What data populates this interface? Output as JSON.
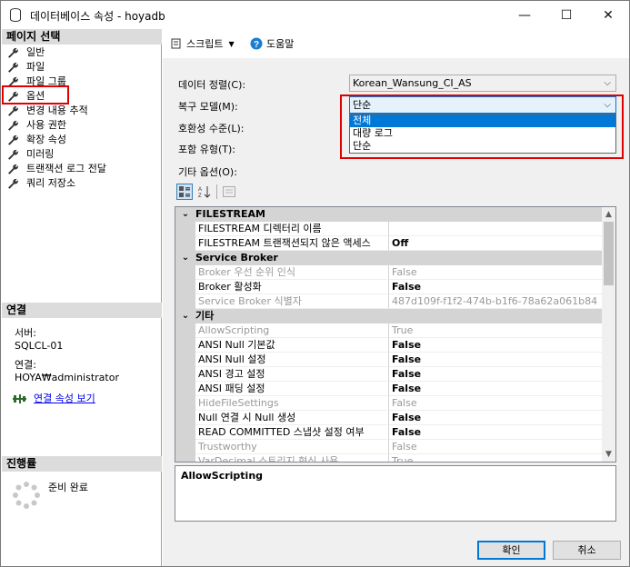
{
  "window": {
    "title": "데이터베이스 속성 - hoyadb",
    "minimize": "—",
    "maximize": "☐",
    "close": "✕"
  },
  "left": {
    "select_page_header": "페이지 선택",
    "pages": [
      "일반",
      "파일",
      "파일 그룹",
      "옵션",
      "변경 내용 추적",
      "사용 권한",
      "확장 속성",
      "미러링",
      "트랜잭션 로그 전달",
      "쿼리 저장소"
    ],
    "selected_page": "옵션",
    "connection_header": "연결",
    "server_label": "서버:",
    "server_value": "SQLCL-01",
    "connection_label": "연결:",
    "connection_value": "HOYA₩administrator",
    "view_connection_link": "연결 속성 보기",
    "progress_header": "진행률",
    "progress_status": "준비 완료"
  },
  "toolbar": {
    "script_label": "스크립트",
    "help_label": "도움말"
  },
  "form": {
    "collation_label": "데이터 정렬(C):",
    "collation_value": "Korean_Wansung_CI_AS",
    "recovery_label": "복구 모델(M):",
    "recovery_value": "단순",
    "recovery_options": [
      "전체",
      "대량 로그",
      "단순"
    ],
    "recovery_highlighted": "전체",
    "compat_label": "호환성 수준(L):",
    "containment_label": "포함 유형(T):",
    "other_options_label": "기타 옵션(O):"
  },
  "grid": {
    "rows": [
      {
        "type": "cat",
        "name": "FILESTREAM"
      },
      {
        "type": "prop",
        "name": "FILESTREAM 디렉터리 이름",
        "value": "",
        "disabled": false,
        "bold": false
      },
      {
        "type": "prop",
        "name": "FILESTREAM 트랜잭션되지 않은 액세스",
        "value": "Off",
        "disabled": false,
        "bold": true
      },
      {
        "type": "cat",
        "name": "Service Broker"
      },
      {
        "type": "prop",
        "name": "Broker 우선 순위 인식",
        "value": "False",
        "disabled": true,
        "bold": false
      },
      {
        "type": "prop",
        "name": "Broker 활성화",
        "value": "False",
        "disabled": false,
        "bold": true
      },
      {
        "type": "prop",
        "name": "Service Broker 식별자",
        "value": "487d109f-f1f2-474b-b1f6-78a62a061b84",
        "disabled": true,
        "bold": false
      },
      {
        "type": "cat",
        "name": "기타"
      },
      {
        "type": "prop",
        "name": "AllowScripting",
        "value": "True",
        "disabled": true,
        "bold": false
      },
      {
        "type": "prop",
        "name": "ANSI Null 기본값",
        "value": "False",
        "disabled": false,
        "bold": true
      },
      {
        "type": "prop",
        "name": "ANSI Null 설정",
        "value": "False",
        "disabled": false,
        "bold": true
      },
      {
        "type": "prop",
        "name": "ANSI 경고 설정",
        "value": "False",
        "disabled": false,
        "bold": true
      },
      {
        "type": "prop",
        "name": "ANSI 패딩 설정",
        "value": "False",
        "disabled": false,
        "bold": true
      },
      {
        "type": "prop",
        "name": "HideFileSettings",
        "value": "False",
        "disabled": true,
        "bold": false
      },
      {
        "type": "prop",
        "name": "Null 연결 시 Null 생성",
        "value": "False",
        "disabled": false,
        "bold": true
      },
      {
        "type": "prop",
        "name": "READ COMMITTED 스냅샷 설정 여부",
        "value": "False",
        "disabled": false,
        "bold": true
      },
      {
        "type": "prop",
        "name": "Trustworthy",
        "value": "False",
        "disabled": true,
        "bold": false
      },
      {
        "type": "prop",
        "name": "VarDecimal 스토리지 형식 사용",
        "value": "True",
        "disabled": true,
        "bold": false
      }
    ],
    "description_title": "AllowScripting"
  },
  "buttons": {
    "ok": "확인",
    "cancel": "취소"
  },
  "colors": {
    "highlight_red": "#e00000",
    "selection_blue": "#0078d7"
  }
}
